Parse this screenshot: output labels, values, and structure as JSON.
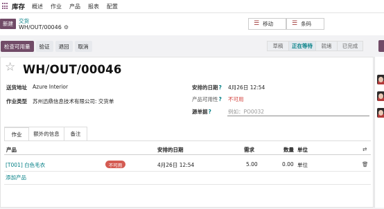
{
  "nav": {
    "app_name": "库存",
    "menu": [
      "概述",
      "作业",
      "产品",
      "报表",
      "配置"
    ]
  },
  "control": {
    "new_label": "新建",
    "breadcrumb_parent": "交货",
    "record_ref": "WH/OUT/00046",
    "switch_move": "移动",
    "switch_barcode": "条码"
  },
  "actions": {
    "check_availability": "检查可用量",
    "validate": "验证",
    "return": "退回",
    "cancel": "取消"
  },
  "status": {
    "steps": [
      "草稿",
      "正在等待",
      "就绪",
      "已完成"
    ],
    "active_index": 1
  },
  "form": {
    "title": "WH/OUT/00046",
    "delivery_address_label": "送货地址",
    "delivery_address": "Azure Interior",
    "operation_type_label": "作业类型",
    "operation_type": "苏州迅鼎信息技术有限公司: 交货单",
    "scheduled_date_label": "安排的日期",
    "scheduled_date": "4月26日 12:54",
    "product_availability_label": "产品可用性",
    "product_availability": "不可用",
    "source_doc_label": "源单据",
    "source_doc_placeholder": "例如：PO0032",
    "help_mark": "?"
  },
  "tabs": [
    "作业",
    "额外的信息",
    "备注"
  ],
  "table": {
    "headers": {
      "product": "产品",
      "scheduled_date": "安排的日期",
      "demand": "需求",
      "quantity": "数量",
      "unit": "单位"
    },
    "rows": [
      {
        "product": "[T001] 白色毛衣",
        "badge": "不可用",
        "scheduled_date": "4月26日 12:54",
        "demand": "5.00",
        "quantity": "0.00",
        "unit": "单位"
      }
    ],
    "add_line": "添加产品"
  },
  "colors": {
    "brand": "#714b67",
    "link": "#017e84",
    "danger": "#d23f3a"
  },
  "icons": [
    "apps-grid-icon",
    "gear-icon",
    "list-icon",
    "barcode-icon",
    "star-icon",
    "column-settings-icon",
    "trash-icon",
    "avatar-icon"
  ]
}
